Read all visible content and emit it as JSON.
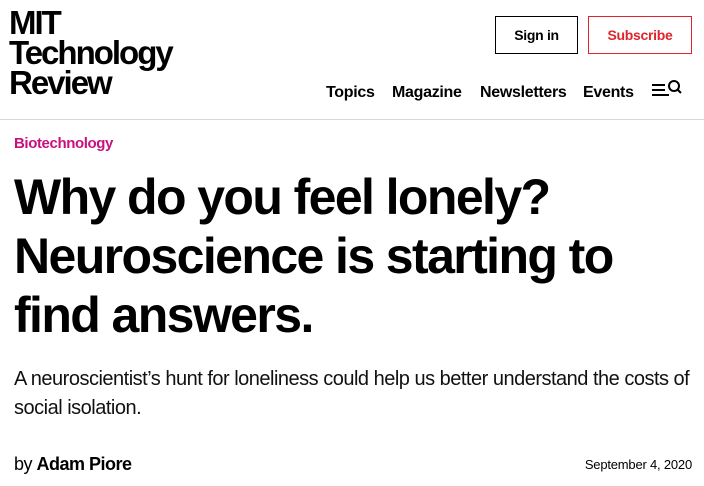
{
  "header": {
    "logo_lines": [
      "MIT",
      "Technology",
      "Review"
    ],
    "signin_label": "Sign in",
    "subscribe_label": "Subscribe",
    "nav": [
      "Topics",
      "Magazine",
      "Newsletters",
      "Events"
    ],
    "menu_icon": "menu-search-icon"
  },
  "article": {
    "category": "Biotechnology",
    "headline": "Why do you feel lonely? Neuroscience is starting to find answers.",
    "dek": "A neuroscientist’s hunt for loneliness could help us better understand the costs of social isolation.",
    "byline_prefix": "by",
    "author": "Adam Piore",
    "date": "September 4, 2020"
  },
  "colors": {
    "accent_subscribe": "#e0242b",
    "category": "#c8107f",
    "text": "#000000",
    "rule": "#d8d8d8"
  }
}
